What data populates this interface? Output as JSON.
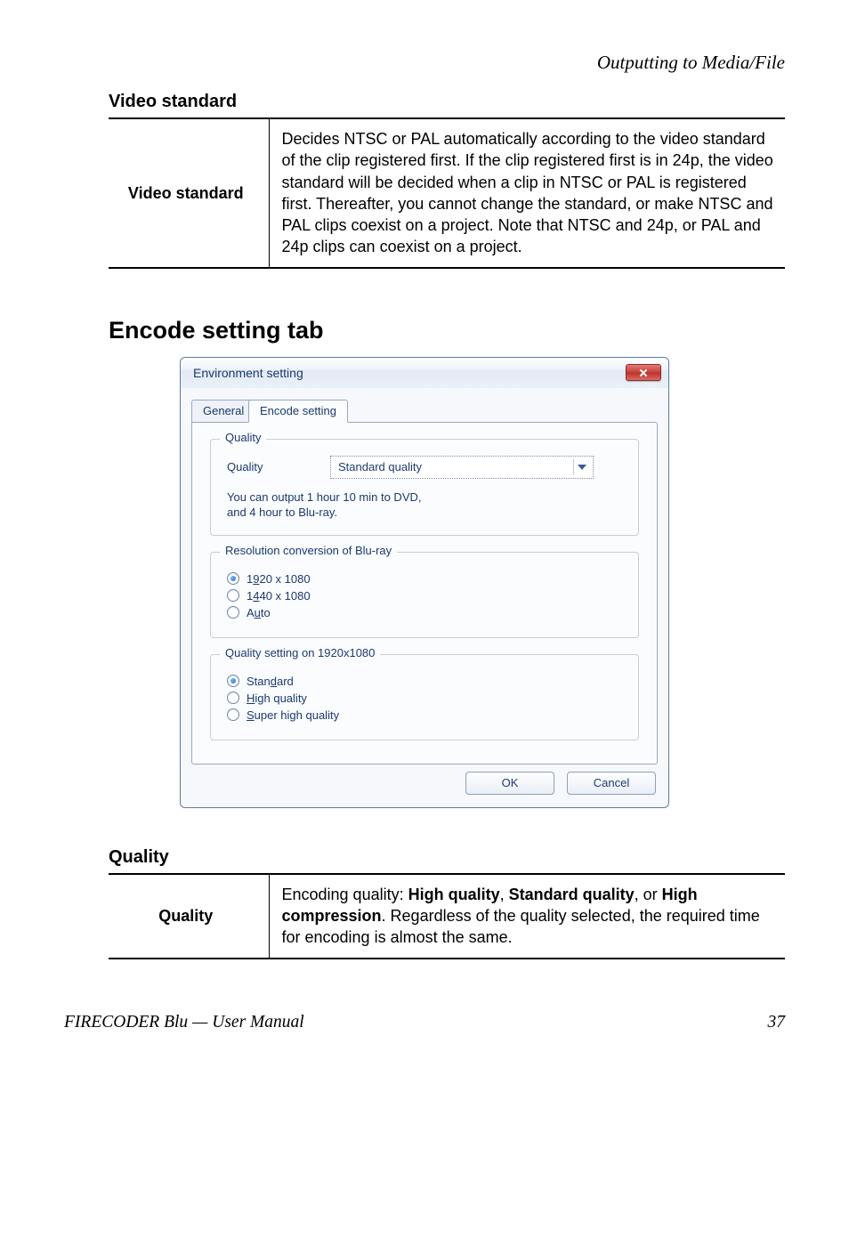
{
  "header": {
    "section": "Outputting to Media/File"
  },
  "video_standard": {
    "heading": "Video standard",
    "label": "Video standard",
    "desc": "Decides NTSC or PAL automatically according to the video standard of the clip registered first. If the clip registered first is in 24p, the video standard will be decided when a clip in NTSC or PAL is registered first. Thereafter, you cannot change the standard, or make NTSC and PAL clips coexist on a project. Note that NTSC and 24p, or PAL and 24p clips can coexist on a project."
  },
  "encode_heading": "Encode setting tab",
  "dialog": {
    "title": "Environment setting",
    "tabs": {
      "general": "General",
      "encode": "Encode setting"
    },
    "quality_group": {
      "legend": "Quality",
      "label": "Quality",
      "value": "Standard quality",
      "note1": "You can output 1 hour 10 min to DVD,",
      "note2": "and 4 hour to Blu-ray."
    },
    "res_group": {
      "legend": "Resolution conversion of Blu-ray",
      "o1": "1920 x 1080",
      "o2": "1440 x 1080",
      "o3": "Auto",
      "u1": "9",
      "u2": "4",
      "u3": "u"
    },
    "qset_group": {
      "legend": "Quality setting on 1920x1080",
      "o1": "Standard",
      "o2": "High quality",
      "o3": "Super high quality",
      "u1": "d",
      "u2": "H",
      "u3": "S"
    },
    "buttons": {
      "ok": "OK",
      "cancel": "Cancel"
    }
  },
  "quality_section": {
    "heading": "Quality",
    "label": "Quality",
    "desc_pre": "Encoding quality: ",
    "b1": "High quality",
    "sep1": ", ",
    "b2": "Standard quality",
    "sep2": ", or ",
    "b3": "High compression",
    "desc_post": ". Regardless of the quality selected, the required time for encoding is almost the same."
  },
  "footer": {
    "left": "FIRECODER Blu  —  User Manual",
    "right": "37"
  }
}
